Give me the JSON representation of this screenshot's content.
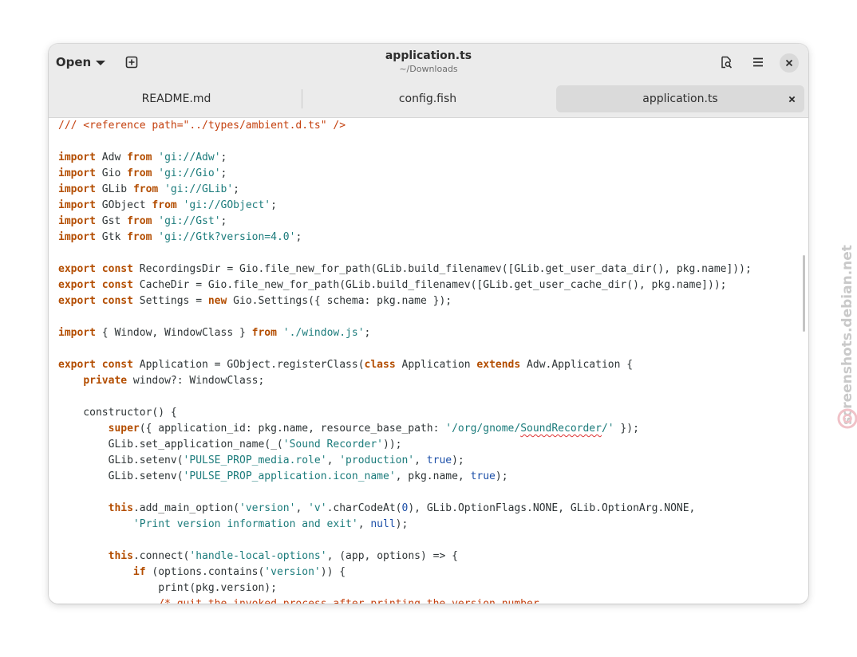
{
  "header": {
    "open_label": "Open",
    "title": "application.ts",
    "subtitle": "~/Downloads",
    "icons": [
      "new-tab-icon",
      "document-search-icon",
      "menu-icon",
      "close-icon"
    ]
  },
  "tabs": [
    {
      "label": "README.md",
      "active": false
    },
    {
      "label": "config.fish",
      "active": false
    },
    {
      "label": "application.ts",
      "active": true
    }
  ],
  "code_lines": [
    [
      [
        "com",
        "/// <reference path=\"../types/ambient.d.ts\" />"
      ]
    ],
    [],
    [
      [
        "kw",
        "import"
      ],
      [
        "t",
        " Adw "
      ],
      [
        "kw",
        "from"
      ],
      [
        "t",
        " "
      ],
      [
        "str",
        "'gi://Adw'"
      ],
      [
        "t",
        ";"
      ]
    ],
    [
      [
        "kw",
        "import"
      ],
      [
        "t",
        " Gio "
      ],
      [
        "kw",
        "from"
      ],
      [
        "t",
        " "
      ],
      [
        "str",
        "'gi://Gio'"
      ],
      [
        "t",
        ";"
      ]
    ],
    [
      [
        "kw",
        "import"
      ],
      [
        "t",
        " GLib "
      ],
      [
        "kw",
        "from"
      ],
      [
        "t",
        " "
      ],
      [
        "str",
        "'gi://GLib'"
      ],
      [
        "t",
        ";"
      ]
    ],
    [
      [
        "kw",
        "import"
      ],
      [
        "t",
        " GObject "
      ],
      [
        "kw",
        "from"
      ],
      [
        "t",
        " "
      ],
      [
        "str",
        "'gi://GObject'"
      ],
      [
        "t",
        ";"
      ]
    ],
    [
      [
        "kw",
        "import"
      ],
      [
        "t",
        " Gst "
      ],
      [
        "kw",
        "from"
      ],
      [
        "t",
        " "
      ],
      [
        "str",
        "'gi://Gst'"
      ],
      [
        "t",
        ";"
      ]
    ],
    [
      [
        "kw",
        "import"
      ],
      [
        "t",
        " Gtk "
      ],
      [
        "kw",
        "from"
      ],
      [
        "t",
        " "
      ],
      [
        "str",
        "'gi://Gtk?version=4.0'"
      ],
      [
        "t",
        ";"
      ]
    ],
    [],
    [
      [
        "kw",
        "export"
      ],
      [
        "t",
        " "
      ],
      [
        "kw",
        "const"
      ],
      [
        "t",
        " RecordingsDir = Gio.file_new_for_path(GLib.build_filenamev([GLib.get_user_data_dir(), pkg.name]));"
      ]
    ],
    [
      [
        "kw",
        "export"
      ],
      [
        "t",
        " "
      ],
      [
        "kw",
        "const"
      ],
      [
        "t",
        " CacheDir = Gio.file_new_for_path(GLib.build_filenamev([GLib.get_user_cache_dir(), pkg.name]));"
      ]
    ],
    [
      [
        "kw",
        "export"
      ],
      [
        "t",
        " "
      ],
      [
        "kw",
        "const"
      ],
      [
        "t",
        " Settings = "
      ],
      [
        "kw",
        "new"
      ],
      [
        "t",
        " Gio.Settings({ schema: pkg.name });"
      ]
    ],
    [],
    [
      [
        "kw",
        "import"
      ],
      [
        "t",
        " { Window, WindowClass } "
      ],
      [
        "kw",
        "from"
      ],
      [
        "t",
        " "
      ],
      [
        "str",
        "'./window.js'"
      ],
      [
        "t",
        ";"
      ]
    ],
    [],
    [
      [
        "kw",
        "export"
      ],
      [
        "t",
        " "
      ],
      [
        "kw",
        "const"
      ],
      [
        "t",
        " Application = GObject.registerClass("
      ],
      [
        "kw",
        "class"
      ],
      [
        "t",
        " Application "
      ],
      [
        "kw",
        "extends"
      ],
      [
        "t",
        " Adw.Application {"
      ]
    ],
    [
      [
        "t",
        "    "
      ],
      [
        "kw",
        "private"
      ],
      [
        "t",
        " window?: WindowClass;"
      ]
    ],
    [],
    [
      [
        "t",
        "    constructor() {"
      ]
    ],
    [
      [
        "t",
        "        "
      ],
      [
        "kw",
        "super"
      ],
      [
        "t",
        "({ application_id: pkg.name, resource_base_path: "
      ],
      [
        "str",
        "'/org/gnome/"
      ],
      [
        "spell",
        "SoundRecorder"
      ],
      [
        "str",
        "/'"
      ],
      [
        "t",
        " });"
      ]
    ],
    [
      [
        "t",
        "        GLib.set_application_name(_("
      ],
      [
        "str",
        "'Sound Recorder'"
      ],
      [
        "t",
        "));"
      ]
    ],
    [
      [
        "t",
        "        GLib.setenv("
      ],
      [
        "str",
        "'PULSE_PROP_media.role'"
      ],
      [
        "t",
        ", "
      ],
      [
        "str",
        "'production'"
      ],
      [
        "t",
        ", "
      ],
      [
        "lit",
        "true"
      ],
      [
        "t",
        ");"
      ]
    ],
    [
      [
        "t",
        "        GLib.setenv("
      ],
      [
        "str",
        "'PULSE_PROP_application.icon_name'"
      ],
      [
        "t",
        ", pkg.name, "
      ],
      [
        "lit",
        "true"
      ],
      [
        "t",
        ");"
      ]
    ],
    [],
    [
      [
        "t",
        "        "
      ],
      [
        "kw",
        "this"
      ],
      [
        "t",
        ".add_main_option("
      ],
      [
        "str",
        "'version'"
      ],
      [
        "t",
        ", "
      ],
      [
        "str",
        "'v'"
      ],
      [
        "t",
        ".charCodeAt("
      ],
      [
        "lit",
        "0"
      ],
      [
        "t",
        "), GLib.OptionFlags.NONE, GLib.OptionArg.NONE,"
      ]
    ],
    [
      [
        "t",
        "            "
      ],
      [
        "str",
        "'Print version information and exit'"
      ],
      [
        "t",
        ", "
      ],
      [
        "lit",
        "null"
      ],
      [
        "t",
        ");"
      ]
    ],
    [],
    [
      [
        "t",
        "        "
      ],
      [
        "kw",
        "this"
      ],
      [
        "t",
        ".connect("
      ],
      [
        "str",
        "'handle-local-options'"
      ],
      [
        "t",
        ", (app, options) => {"
      ]
    ],
    [
      [
        "t",
        "            "
      ],
      [
        "kw",
        "if"
      ],
      [
        "t",
        " (options.contains("
      ],
      [
        "str",
        "'version'"
      ],
      [
        "t",
        ")) {"
      ]
    ],
    [
      [
        "t",
        "                print(pkg.version);"
      ]
    ],
    [
      [
        "t",
        "                "
      ],
      [
        "com",
        "/* quit the invoked process after printing the version number"
      ]
    ]
  ],
  "watermark": "screenshots.debian.net"
}
